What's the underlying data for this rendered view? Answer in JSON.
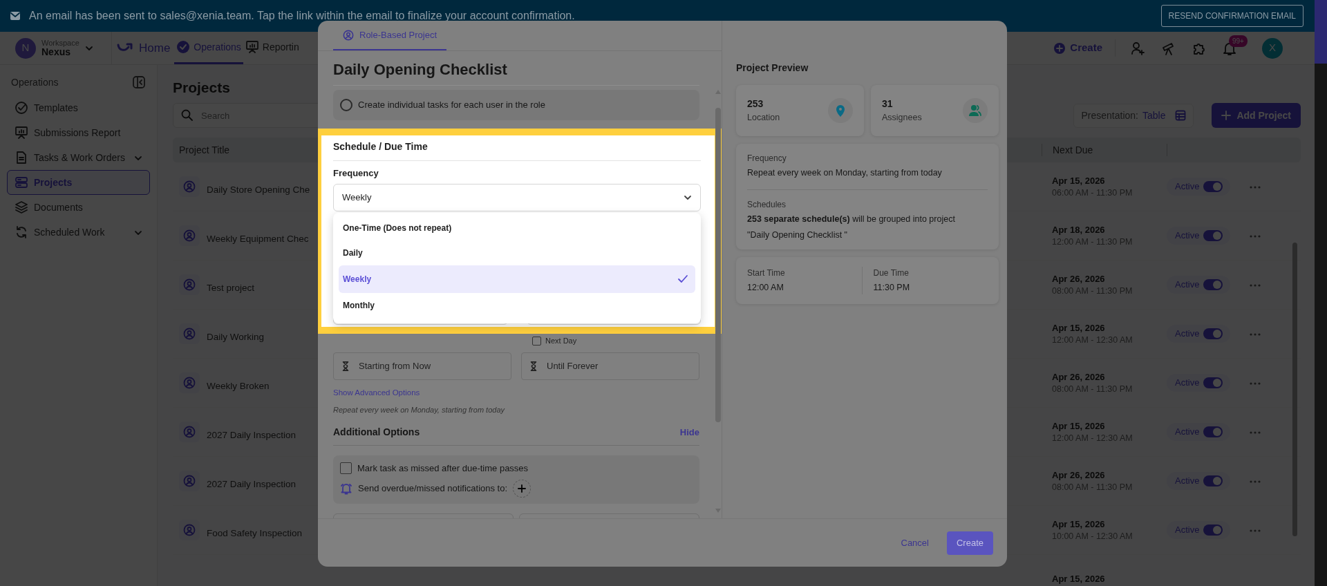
{
  "banner": {
    "message": "An email has been sent to sales@xenia.team. Tap the link within the email to finalize your account confirmation.",
    "button": "RESEND CONFIRMATION EMAIL"
  },
  "top_nav": {
    "avatar_letter": "N",
    "workspace_label": "Workspace",
    "workspace_name": "Nexus",
    "home": "Home",
    "tabs": [
      {
        "label": "Operations",
        "selected": true
      },
      {
        "label": "Reportin",
        "selected": false
      }
    ],
    "create": "Create",
    "notification_badge": "99+",
    "user_avatar": "X"
  },
  "sidebar": {
    "heading": "Operations",
    "items": [
      {
        "label": "Templates",
        "selected": false
      },
      {
        "label": "Submissions Report",
        "selected": false
      },
      {
        "label": "Tasks & Work Orders",
        "selected": false,
        "expanded": false
      },
      {
        "label": "Projects",
        "selected": true
      },
      {
        "label": "Documents",
        "selected": false
      },
      {
        "label": "Scheduled Work",
        "selected": false,
        "expanded": false
      }
    ]
  },
  "projects_page": {
    "title": "Projects",
    "search": {
      "placeholder": "Search"
    },
    "presentation_label": "Presentation:",
    "presentation_value": "Table",
    "add_button": "Add Project",
    "columns": [
      "Project Title",
      "Next Due"
    ],
    "rows": [
      {
        "title": "Daily Store Opening Che",
        "next_due_date": "Apr 15, 2026",
        "next_due_time": "06:00 AM - 11:30 PM",
        "status": "Active",
        "on": true
      },
      {
        "title": "Weekly Equipment Chec",
        "next_due_date": "Apr 18, 2026",
        "next_due_time": "12:00 AM - 11:30 PM",
        "status": "Active",
        "on": true
      },
      {
        "title": "Test project",
        "next_due_date": "Apr 26, 2026",
        "next_due_time": "08:00 AM - 11:30 PM",
        "status": "Active",
        "on": true
      },
      {
        "title": "Daily Working",
        "next_due_date": "Apr 15, 2026",
        "next_due_time": "12:00 AM - 12:30 AM",
        "status": "Active",
        "on": true
      },
      {
        "title": "Weekly Broken",
        "next_due_date": "Apr 26, 2026",
        "next_due_time": "08:00 AM - 11:30 PM",
        "status": "Active",
        "on": true
      },
      {
        "title": "2027 Daily Inspection",
        "next_due_date": "Apr 15, 2026",
        "next_due_time": "12:00 AM - 12:30 AM",
        "status": "Active",
        "on": true
      },
      {
        "title": "2027 Daily Inspection",
        "next_due_date": "Apr 26, 2026",
        "next_due_time": "08:00 AM - 11:30 PM",
        "status": "Active",
        "on": true
      },
      {
        "title": "Food Safety Inspection",
        "next_due_date": "Apr 15, 2026",
        "next_due_time": "10:00 AM - 12:30 AM",
        "status": "Active",
        "on": true
      },
      {
        "next_due_date": "Apr 15, 2026"
      }
    ]
  },
  "modal": {
    "tab": {
      "label": "Role-Based Project",
      "selected": true
    },
    "title": "Daily Opening Checklist",
    "role_option": {
      "label": "Create individual tasks for each user in the role",
      "checked": false
    },
    "schedule": {
      "heading": "Schedule / Due Time",
      "frequency_label": "Frequency",
      "frequency_value": "Weekly",
      "options": [
        {
          "label": "One-Time (Does not repeat)",
          "selected": false
        },
        {
          "label": "Daily",
          "selected": false
        },
        {
          "label": "Weekly",
          "selected": true
        },
        {
          "label": "Monthly",
          "selected": false
        }
      ],
      "next_day": {
        "label": "Next Day",
        "checked": false
      },
      "start": "Starting from Now",
      "end": "Until Forever",
      "advanced_link": "Show Advanced Options",
      "summary": "Repeat every week on Monday, starting from today"
    },
    "additional": {
      "heading": "Additional Options",
      "toggle": "Hide",
      "missed": {
        "label": "Mark task as missed after due-time passes",
        "checked": false
      },
      "notify_label": "Send overdue/missed notifications to:"
    },
    "preview": {
      "heading": "Project Preview",
      "stats": [
        {
          "value": "253",
          "label": "Location",
          "kind": "location"
        },
        {
          "value": "31",
          "label": "Assignees",
          "kind": "people"
        }
      ],
      "frequency_label": "Frequency",
      "frequency_text": "Repeat every week on Monday, starting from today",
      "schedules_label": "Schedules",
      "schedules_text": "**253 separate schedule(s)** will be grouped into project",
      "schedules_project": "\"Daily Opening Checklist \"",
      "start_label": "Start Time",
      "start_value": "12:00 AM",
      "due_label": "Due Time",
      "due_value": "11:30 PM"
    },
    "buttons": {
      "cancel": "Cancel",
      "create": "Create"
    }
  }
}
